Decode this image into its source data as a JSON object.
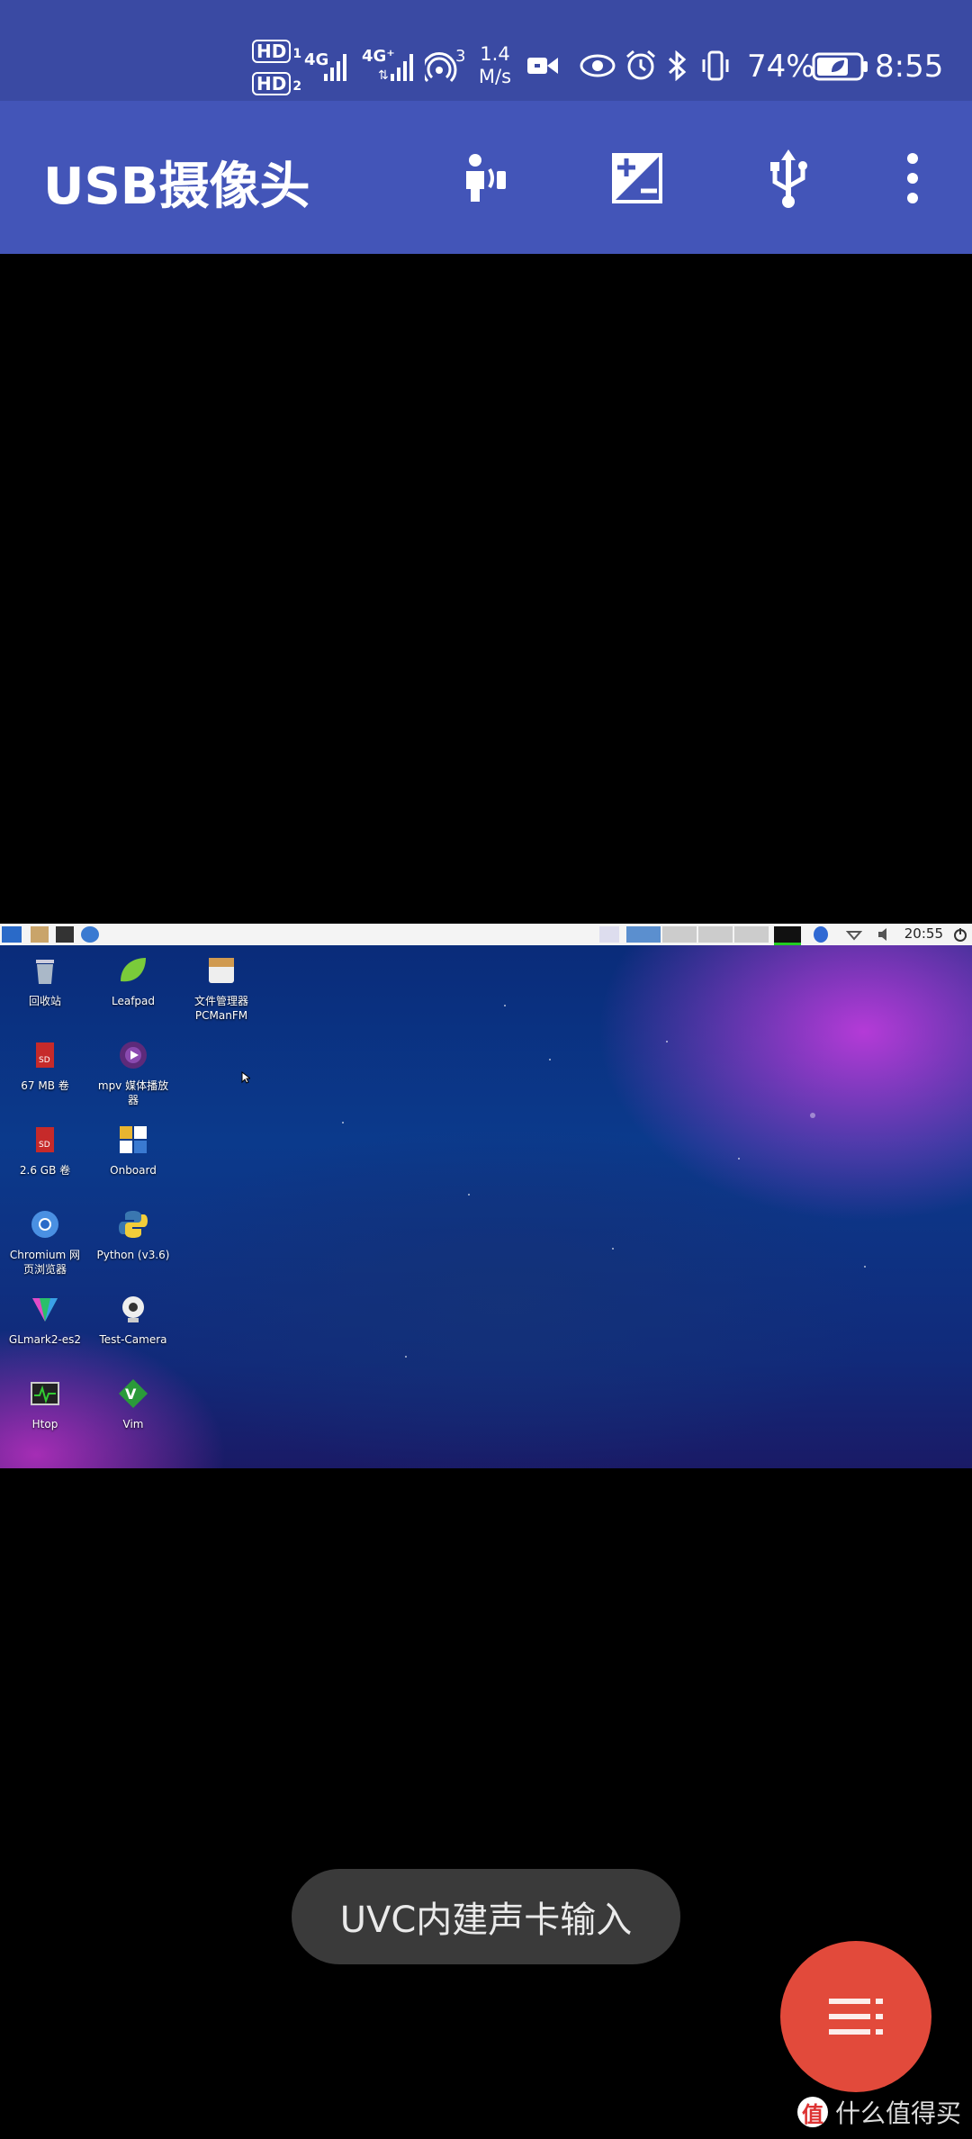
{
  "status_bar": {
    "hd1": "HD",
    "hd1_sub": "1",
    "hd2": "HD",
    "hd2_sub": "2",
    "net1": "4G",
    "net2": "4G⁺",
    "hotspot_count": "3",
    "speed_value": "1.4",
    "speed_unit": "M/s",
    "battery": "74%",
    "time": "8:55"
  },
  "app_bar": {
    "title": "USB摄像头",
    "icons": [
      "voice-assist-icon",
      "exposure-icon",
      "usb-icon",
      "more-vert-icon"
    ]
  },
  "desktop": {
    "taskbar_time": "20:55",
    "icons": [
      {
        "label": "回收站",
        "icon": "trash-icon"
      },
      {
        "label": "Leafpad",
        "icon": "leafpad-icon"
      },
      {
        "label": "文件管理器\nPCManFM",
        "icon": "file-manager-icon"
      },
      {
        "label": "67 MB 卷",
        "icon": "sd-card-icon"
      },
      {
        "label": "mpv 媒体播放\n器",
        "icon": "mpv-icon"
      },
      {
        "label": "2.6 GB 卷",
        "icon": "sd-card-icon"
      },
      {
        "label": "Onboard",
        "icon": "onboard-icon"
      },
      {
        "label": "Chromium 网\n页浏览器",
        "icon": "chromium-icon"
      },
      {
        "label": "Python (v3.6)",
        "icon": "python-icon"
      },
      {
        "label": "GLmark2-es2",
        "icon": "glmark-icon"
      },
      {
        "label": "Test-Camera",
        "icon": "camera-icon"
      },
      {
        "label": "Htop",
        "icon": "htop-icon"
      },
      {
        "label": "Vim",
        "icon": "vim-icon"
      }
    ]
  },
  "toast": {
    "text": "UVC内建声卡输入"
  },
  "watermark": {
    "text": "什么值得买",
    "logo_char": "值"
  },
  "colors": {
    "status_bar": "#3a4aa3",
    "app_bar": "#4355b8",
    "fab": "#e24a3b"
  }
}
